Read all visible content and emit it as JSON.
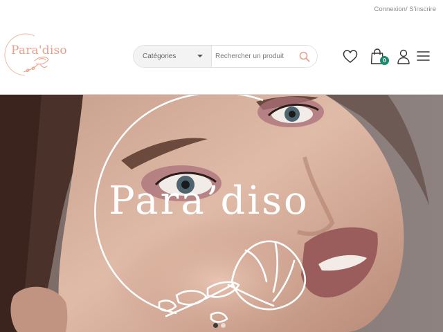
{
  "topbar": {
    "login_link": "Connexion",
    "separator": "/",
    "register_link": " S'inscrire"
  },
  "header": {
    "logo_text": "Para'diso",
    "category_select": {
      "selected": "Catégories"
    },
    "search": {
      "placeholder": "Rechercher un produit"
    },
    "icons": {
      "wishlist": "heart-icon",
      "cart": "shopping-bag-icon",
      "account": "user-icon",
      "menu": "hamburger-menu-icon",
      "search": "search-icon"
    },
    "cart_count": "0"
  },
  "hero": {
    "logo_text": "Para’diso",
    "slides_total": 2,
    "active_slide": 1
  },
  "colors": {
    "brand_peach": "#e8a18a",
    "cart_badge": "#1d8a6f",
    "search_icon": "#e8a18a"
  }
}
